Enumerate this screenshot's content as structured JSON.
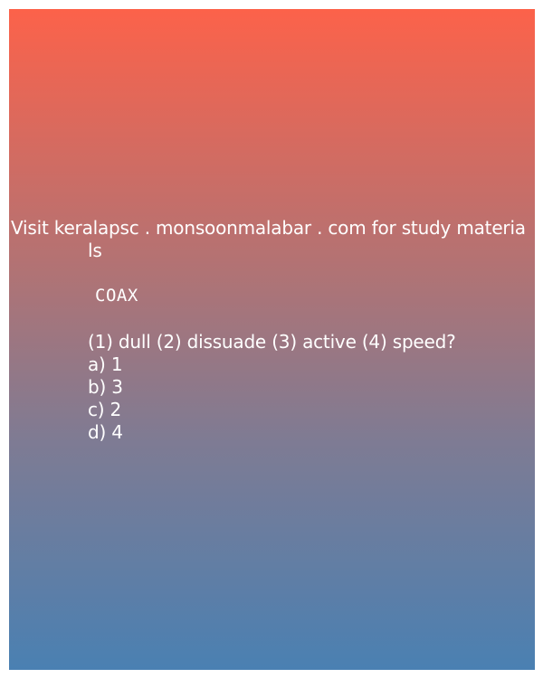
{
  "promo": {
    "line1": "Visit keralapsc . monsoonmalabar . com for study materia",
    "line2": "ls"
  },
  "question": {
    "word": "COAX",
    "prompt": "(1) dull (2) dissuade (3) active (4) speed?",
    "options": [
      "a) 1",
      "b) 3",
      "c) 2",
      "d) 4"
    ]
  }
}
